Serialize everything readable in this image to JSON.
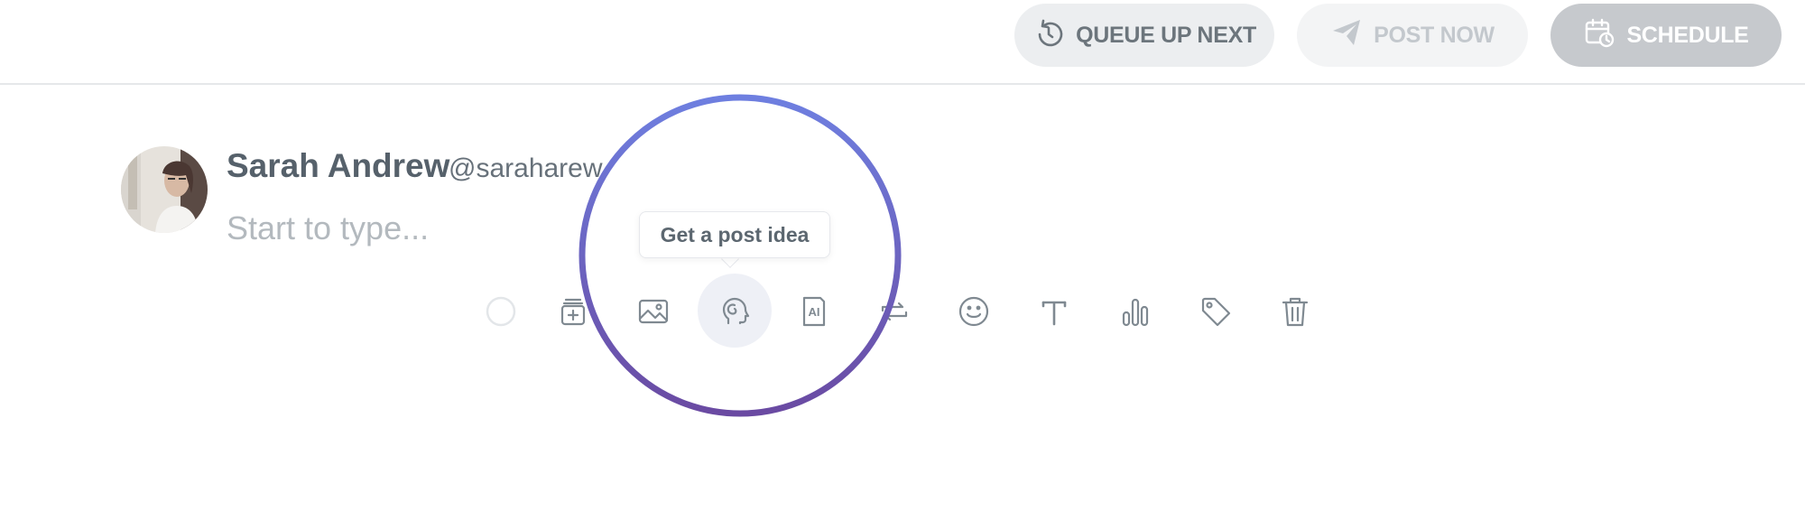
{
  "header": {
    "queue_label": "QUEUE UP NEXT",
    "post_now_label": "POST NOW",
    "schedule_label": "SCHEDULE"
  },
  "author": {
    "name": "Sarah Andrew",
    "handle": "@saraharew"
  },
  "composer": {
    "placeholder": "Start to type..."
  },
  "toolbar": {
    "tooltip": "Get a post idea",
    "ai_icon_text": "AI",
    "icons": [
      "circle-icon",
      "add-media-icon",
      "image-icon",
      "post-idea-icon",
      "ai-icon",
      "repeat-icon",
      "emoji-icon",
      "text-format-icon",
      "chart-icon",
      "tag-icon",
      "trash-icon"
    ]
  },
  "colors": {
    "ring_top": "#6e7fe0",
    "ring_bottom": "#6a4aa2",
    "icon": "#7f8991",
    "queue_bg": "#eceef0",
    "schedule_bg": "#c6c9cd"
  }
}
